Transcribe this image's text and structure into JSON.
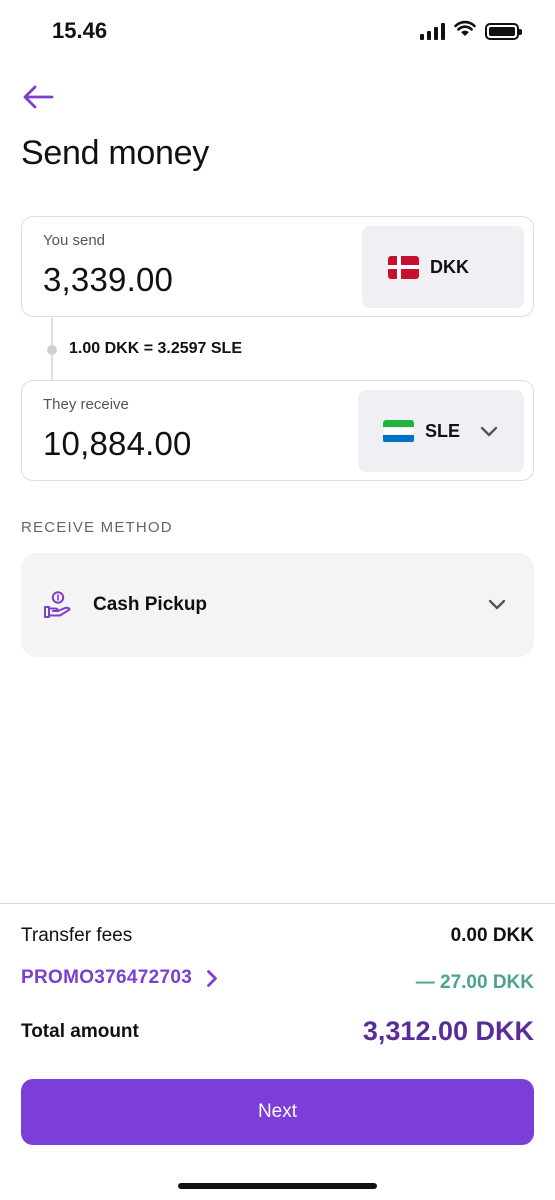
{
  "status_bar": {
    "time": "15.46",
    "icons": [
      "signal-icon",
      "wifi-icon",
      "battery-icon"
    ]
  },
  "header": {
    "back_icon": "arrow-left-icon",
    "title": "Send money"
  },
  "send": {
    "label": "You send",
    "amount": "3,339.00",
    "currency": "DKK",
    "flag": "denmark-flag-icon"
  },
  "rate": {
    "text": "1.00 DKK = 3.2597 SLE"
  },
  "receive": {
    "label": "They receive",
    "amount": "10,884.00",
    "currency": "SLE",
    "flag": "sierra-leone-flag-icon",
    "chevron": "chevron-down-icon"
  },
  "receive_method": {
    "section_label": "RECEIVE METHOD",
    "selected": "Cash Pickup",
    "icon": "cash-hand-icon",
    "chevron": "chevron-down-icon"
  },
  "summary": {
    "fees_label": "Transfer fees",
    "fees_value": "0.00 DKK",
    "promo_code": "PROMO376472703",
    "promo_discount": "— 27.00 DKK",
    "total_label": "Total amount",
    "total_value": "3,312.00 DKK"
  },
  "next_button": {
    "label": "Next"
  },
  "colors": {
    "accent": "#7b3ed7",
    "discount": "#4aa38a",
    "total": "#5a2c9a"
  }
}
